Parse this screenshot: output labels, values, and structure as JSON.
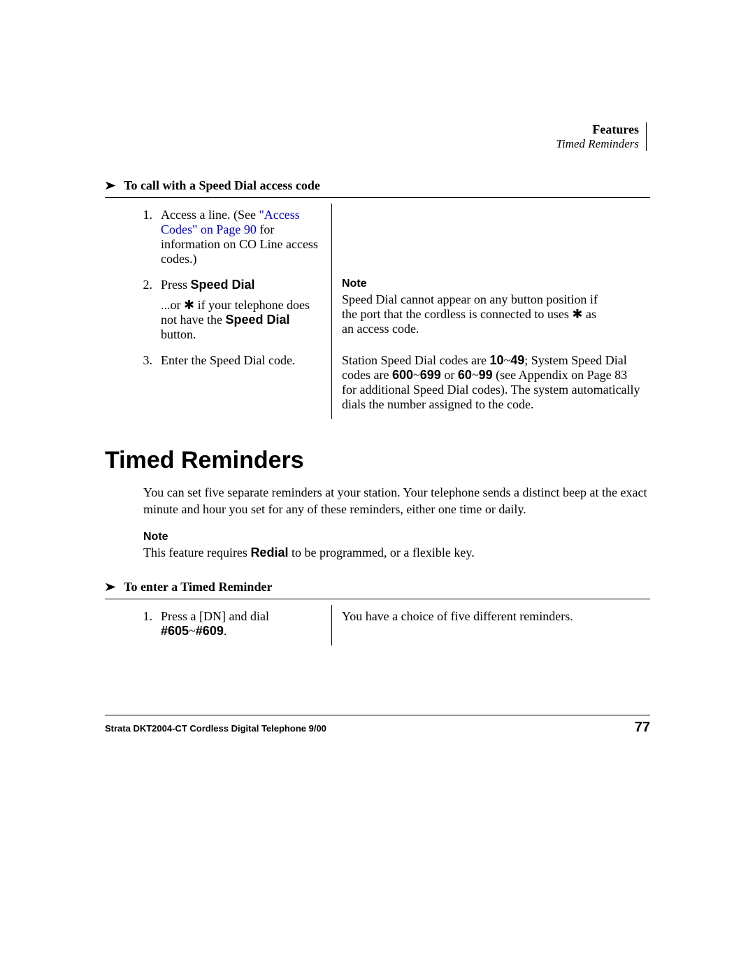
{
  "header": {
    "section": "Features",
    "subsection": "Timed Reminders"
  },
  "proc1": {
    "title": "To call with a Speed Dial access code",
    "steps": {
      "n1": "1.",
      "s1a": "Access a line. (See",
      "s1b": "\"Access Codes\" on Page 90",
      "s1c": " for information on CO Line access codes.)",
      "n2": "2.",
      "s2a": "Press ",
      "s2b": "Speed Dial",
      "s2c": "...or ",
      "s2d": " if your telephone does not have the ",
      "s2e": "Speed Dial",
      "s2f": " button.",
      "note2_label": "Note",
      "note2_body_a": "Speed Dial cannot appear on any button position if the port that the cordless is connected to uses ",
      "note2_body_b": " as an access code.",
      "n3": "3.",
      "s3a": "Enter the Speed Dial code.",
      "r3a": "Station Speed Dial codes are ",
      "r3b": "10",
      "r3c": "~",
      "r3d": "49",
      "r3e": "; System Speed Dial codes are ",
      "r3f": "600",
      "r3g": "~",
      "r3h": "699",
      "r3i": " or ",
      "r3j": "60",
      "r3k": "~",
      "r3l": "99",
      "r3m": " (see Appendix on Page 83 for additional Speed Dial codes). The system automatically dials the number assigned to the code."
    }
  },
  "section_title": "Timed Reminders",
  "body": "You can set five separate reminders at your station. Your telephone sends a distinct beep at the exact minute and hour you set for any of these reminders, either one time or daily.",
  "body_note_label": "Note",
  "body_note_a": "This feature requires ",
  "body_note_b": "Redial",
  "body_note_c": " to be programmed, or a flexible key.",
  "proc2": {
    "title": "To enter a Timed Reminder",
    "n1": "1.",
    "s1a": "Press a [DN] and dial ",
    "s1b": "#605",
    "s1c": "~",
    "s1d": "#609",
    "s1e": ".",
    "r1": "You have a choice of five different reminders."
  },
  "footer": {
    "left": "Strata DKT2004-CT Cordless Digital Telephone   9/00",
    "page": "77"
  },
  "glyphs": {
    "star": "✱",
    "arrow": "➤"
  }
}
